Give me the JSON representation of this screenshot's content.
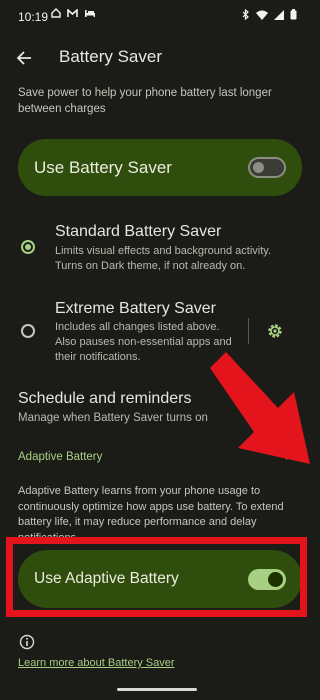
{
  "status_bar": {
    "time": "10:19",
    "left_icons": [
      "home-icon",
      "gmail-icon",
      "bed-icon"
    ],
    "right_icons": [
      "bluetooth-icon",
      "wifi-icon",
      "signal-icon",
      "battery-icon"
    ]
  },
  "app_bar": {
    "title": "Battery Saver"
  },
  "description": "Save power to help your phone battery last longer between charges",
  "master_toggle": {
    "label": "Use Battery Saver",
    "state": "off"
  },
  "options": [
    {
      "title": "Standard Battery Saver",
      "subtitle": "Limits visual effects and background activity. Turns on Dark theme, if not already on.",
      "selected": true
    },
    {
      "title": "Extreme Battery Saver",
      "subtitle": "Includes all changes listed above. Also pauses non-essential apps and their notifications.",
      "selected": false
    }
  ],
  "schedule": {
    "title": "Schedule and reminders",
    "subtitle": "Manage when Battery Saver turns on"
  },
  "adaptive": {
    "header": "Adaptive Battery",
    "description": "Adaptive Battery learns from your phone usage to continuously optimize how apps use battery. To extend battery life, it may reduce performance and delay notifications.",
    "toggle_label": "Use Adaptive Battery",
    "toggle_state": "on"
  },
  "footer": {
    "learn_more": "Learn more about Battery Saver"
  },
  "colors": {
    "accent": "#a7d082",
    "card": "#2f4d0c",
    "background": "#1b1c18",
    "annotation_red": "#e3141b"
  }
}
